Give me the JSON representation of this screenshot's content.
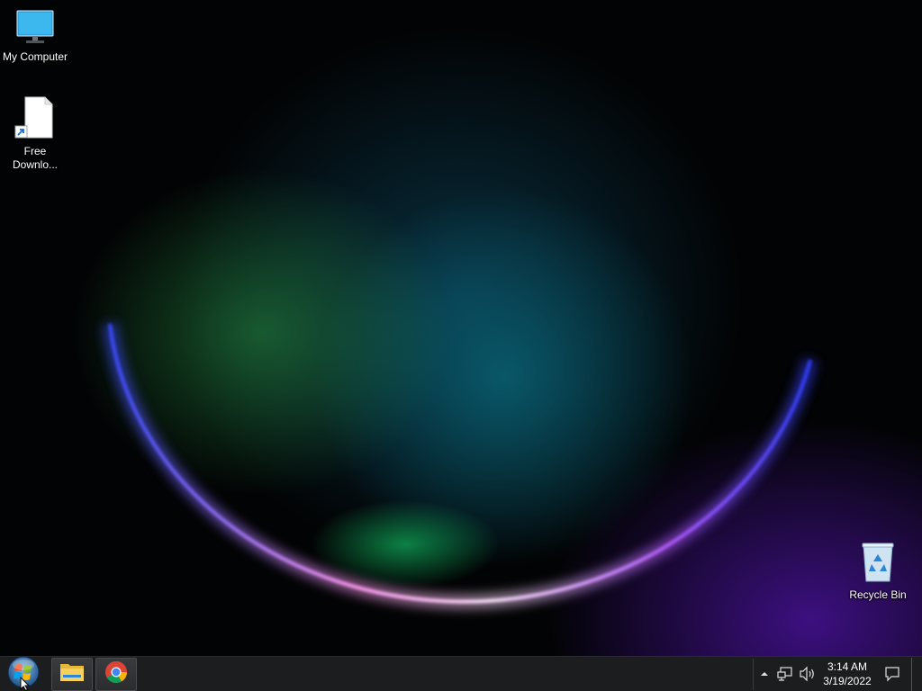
{
  "desktop": {
    "icons": {
      "my_computer": {
        "label": "My Computer",
        "icon": "monitor-icon"
      },
      "free_download": {
        "label_line1": "Free",
        "label_line2": "Downlo...",
        "icon": "document-shortcut-icon"
      },
      "recycle_bin": {
        "label": "Recycle Bin",
        "icon": "recycle-bin-icon"
      }
    }
  },
  "taskbar": {
    "start": {
      "icon": "windows-logo-icon"
    },
    "pinned": [
      {
        "icon": "file-explorer-icon"
      },
      {
        "icon": "chrome-icon"
      }
    ],
    "tray": {
      "icons": [
        "show-hidden-icons-arrow",
        "network-icon",
        "volume-icon",
        "action-center-icon"
      ]
    },
    "clock": {
      "time": "3:14 AM",
      "date": "3/19/2022"
    }
  },
  "colors": {
    "taskbar_bg": "#1c1d1f",
    "wallpaper_teal": "#0a6e82",
    "wallpaper_violet": "#5014aa",
    "wallpaper_rim": "#ff8cf0"
  }
}
